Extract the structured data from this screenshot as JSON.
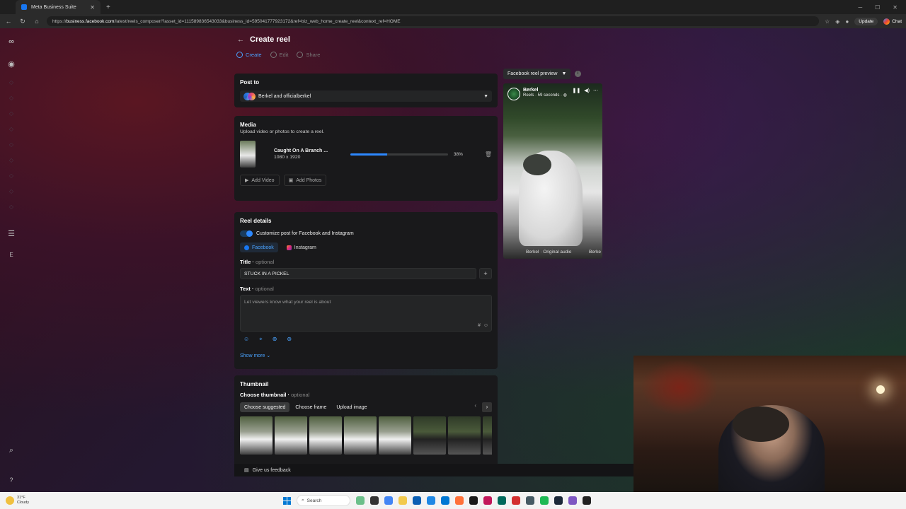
{
  "browser": {
    "tab_title": "Meta Business Suite",
    "url_domain": "business.facebook.com",
    "url_prefix": "https://",
    "url_path": "/latest/reels_composer/?asset_id=111589836543033&business_id=595041777923172&ref=biz_web_home_create_reel&context_ref=HOME",
    "update_label": "Update",
    "chat_label": "Chat"
  },
  "page": {
    "title": "Create reel",
    "steps": [
      {
        "label": "Create"
      },
      {
        "label": "Edit"
      },
      {
        "label": "Share"
      }
    ]
  },
  "post_to": {
    "heading": "Post to",
    "selected": "Berkel and officialberkel"
  },
  "media": {
    "heading": "Media",
    "subtext": "Upload video or photos to create a reel.",
    "file_name": "Caught On A Branch ...",
    "file_dims": "1080 x 1920",
    "progress": 38,
    "progress_label": "38%",
    "add_video": "Add Video",
    "add_photos": "Add Photos"
  },
  "reel_details": {
    "heading": "Reel details",
    "customize_label": "Customize post for Facebook and Instagram",
    "tabs": [
      {
        "label": "Facebook"
      },
      {
        "label": "Instagram"
      }
    ],
    "title_label": "Title",
    "optional": "optional",
    "title_value": "STUCK IN A PICKEL",
    "text_label": "Text",
    "text_placeholder": "Let viewers know what your reel is about",
    "show_more": "Show more"
  },
  "thumbnail": {
    "heading": "Thumbnail",
    "choose_label": "Choose thumbnail",
    "options": [
      {
        "label": "Choose suggested"
      },
      {
        "label": "Choose frame"
      },
      {
        "label": "Upload image"
      }
    ]
  },
  "feedback": {
    "label": "Give us feedback"
  },
  "preview": {
    "selector": "Facebook reel preview",
    "page_name": "Berkel",
    "meta": "Reels · 59 seconds · ",
    "audio": "Berkel · Original audio",
    "audio_trail": "Berke"
  },
  "taskbar": {
    "temp": "31°F",
    "condition": "Cloudy",
    "search": "Search"
  }
}
